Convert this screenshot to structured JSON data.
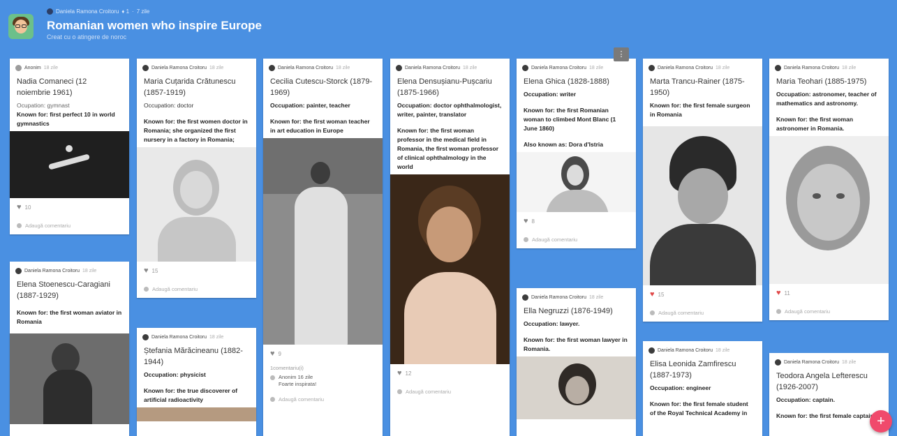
{
  "header": {
    "author": "Daniela Ramona Croitoru",
    "likes_meta": "♦ 1",
    "age": "7 zile",
    "title": "Romanian women who inspire Europe",
    "subtitle": "Creat cu o atingere de noroc"
  },
  "common": {
    "add_comment": "Adaugă comentariu"
  },
  "fab_label": "+",
  "menu_label": "⋮",
  "cards": [
    {
      "author": "Anonim",
      "time": "18 zile",
      "title": "Nadia Comaneci (12 noiembrie 1961)",
      "occupation": "Ocupation: gymnast",
      "known": "Known for: first perfect 10 in world gymnastics",
      "likes": "10"
    },
    {
      "author": "Daniela Ramona Croitoru",
      "time": "18 zile",
      "title": "Maria Cuțarida Crătunescu (1857-1919)",
      "occupation": "Occupation: doctor",
      "known": "Known for:  the first women doctor in Romania; she organized the first nursery in a factory in Romania;",
      "likes": "15"
    },
    {
      "author": "Daniela Ramona Croitoru",
      "time": "18 zile",
      "title": "Cecilia Cutescu-Storck (1879-1969)",
      "occupation": "Occupation: painter, teacher",
      "known": "Known for:  the first woman teacher in art education in Europe",
      "likes": "9",
      "comments_label": "1comentariu(i)",
      "reply_author": "Anonim 16 zile",
      "reply_text": "Foarte inspirata!"
    },
    {
      "author": "Daniela Ramona Croitoru",
      "time": "18 zile",
      "title": "Elena Densușianu-Pușcariu (1875-1966)",
      "occupation": "Occupation: doctor ophthalmologist, writer, painter, translator",
      "known": "Known for: the first woman professor in the medical field in Romania, the first woman professor of clinical ophthalmology in the world",
      "likes": "12"
    },
    {
      "author": "Daniela Ramona Croitoru",
      "time": "18 zile",
      "title": "Elena Ghica (1828-1888)",
      "occupation": "Occupation: writer",
      "known": "Known for: the first Romanian woman to climbed Mont Blanc (1 June 1860)",
      "also": "Also known as: Dora d'Istria",
      "likes": "8"
    },
    {
      "author": "Daniela Ramona Croitoru",
      "time": "18 zile",
      "title": "Marta Trancu-Rainer (1875-1950)",
      "known": "Known for: the first female surgeon in Romania",
      "likes": "15"
    },
    {
      "author": "Daniela Ramona Croitoru",
      "time": "18 zile",
      "title": "Maria Teohari (1885-1975)",
      "occupation": "Occupation: astronomer, teacher of mathematics and astronomy.",
      "known": "Known for: the first woman astronomer in Romania.",
      "likes": "11"
    },
    {
      "author": "Daniela Ramona Croitoru",
      "time": "18 zile",
      "title": "Elena Stoenescu-Caragiani (1887-1929)",
      "known": "Known for: the first woman aviator in Romania"
    },
    {
      "author": "Daniela Ramona Croitoru",
      "time": "18 zile",
      "title": "Ștefania Mărăcineanu (1882-1944)",
      "occupation": "Occupation: physicist",
      "known": "Known for: the true discoverer of artificial radioactivity"
    },
    {
      "author": "Daniela Ramona Croitoru",
      "time": "18 zile",
      "title": "Ella Negruzzi (1876-1949)",
      "occupation": "Occupation: lawyer.",
      "known": "Known for: the first woman lawyer in Romania."
    },
    {
      "author": "Daniela Ramona Croitoru",
      "time": "18 zile",
      "title": "Elisa Leonida Zamfirescu (1887-1973)",
      "occupation": "Occupation: engineer",
      "known": "Known for: the first female student of the Royal Technical Academy in"
    },
    {
      "author": "Daniela Ramona Croitoru",
      "time": "18 zile",
      "title": "Teodora Angela Lefterescu (1926-2007)",
      "occupation": "Occupation: captain.",
      "known": "Known for: the first female captain"
    }
  ]
}
